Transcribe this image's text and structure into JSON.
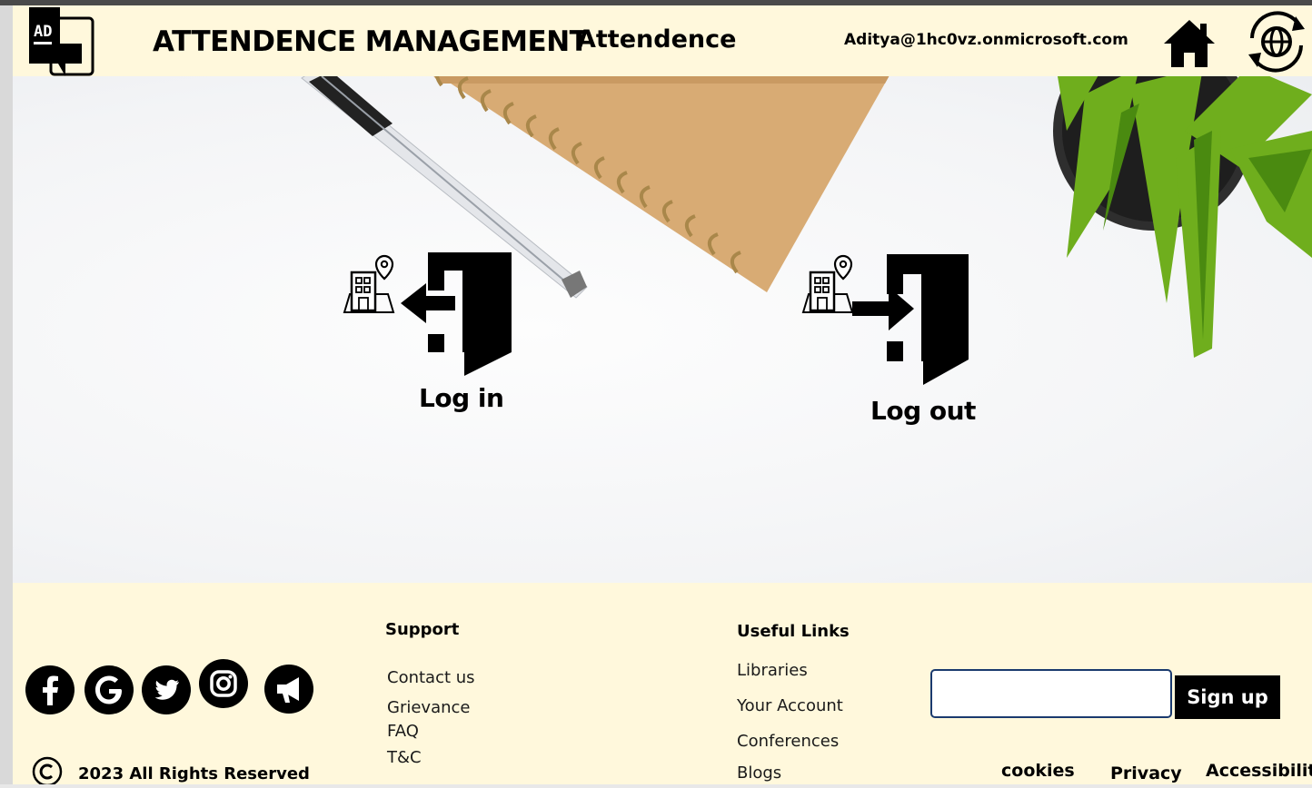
{
  "header": {
    "logo_text": "AD",
    "app_title": "ATTENDENCE MANAGEMENT",
    "page_name": "Attendence",
    "user_email": "Aditya@1hc0vz.onmicrosoft.com",
    "home_icon": "home-icon",
    "language_icon": "globe-refresh-icon"
  },
  "actions": {
    "login_label": "Log in",
    "logout_label": "Log out"
  },
  "footer": {
    "social_icons": [
      "facebook-icon",
      "google-icon",
      "twitter-icon",
      "instagram-icon",
      "megaphone-icon"
    ],
    "copyright": "2023 All Rights Reserved",
    "support": {
      "heading": "Support",
      "links": [
        "Contact us",
        "Grievance",
        "FAQ",
        "T&C"
      ]
    },
    "useful_links": {
      "heading": "Useful Links",
      "links": [
        "Libraries",
        "Your Account",
        "Conferences",
        "Blogs"
      ]
    },
    "signup": {
      "input_value": "",
      "button_label": "Sign up"
    },
    "legal": {
      "cookies": "cookies",
      "privacy": "Privacy",
      "accessibility": "Accessibility"
    }
  },
  "colors": {
    "header_bg": "#fff8dc",
    "footer_bg": "#fff8dc",
    "input_border": "#1a3a6e",
    "button_bg": "#000000"
  }
}
